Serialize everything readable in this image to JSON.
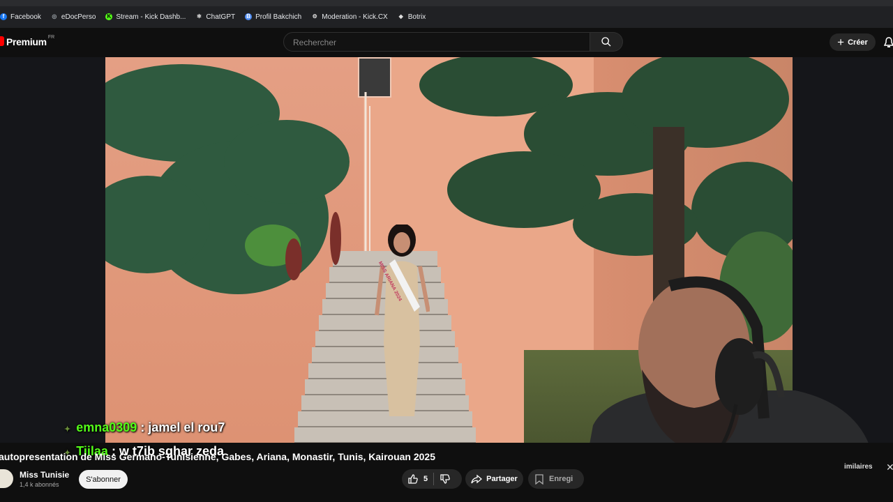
{
  "bookmarks": [
    {
      "label": "Facebook",
      "icon": "facebook-icon",
      "color": "#1877f2",
      "glyph": "f"
    },
    {
      "label": "eDocPerso",
      "icon": "globe-icon",
      "color": "#9aa0a6",
      "glyph": "◎"
    },
    {
      "label": "Stream - Kick Dashb...",
      "icon": "kick-icon",
      "color": "#53fc18",
      "glyph": "K"
    },
    {
      "label": "ChatGPT",
      "icon": "chatgpt-icon",
      "color": "#dddddd",
      "glyph": "✻"
    },
    {
      "label": "Profil Bakchich",
      "icon": "profile-icon",
      "color": "#4f8df5",
      "glyph": "B"
    },
    {
      "label": "Moderation - Kick.CX",
      "icon": "gear-icon",
      "color": "#dddddd",
      "glyph": "⚙"
    },
    {
      "label": "Botrix",
      "icon": "botrix-icon",
      "color": "#dddddd",
      "glyph": "◆"
    }
  ],
  "header": {
    "logo": "Premium",
    "region": "FR",
    "search_placeholder": "Rechercher",
    "create_label": "Créer"
  },
  "chat": [
    {
      "user": "emna0309",
      "message": ": jamel el rou7"
    },
    {
      "user": "Tiilaa",
      "message": ": w t7ib sghar zeda"
    }
  ],
  "video": {
    "sash_text": "MISS ARIANA 2024",
    "title": "autopresentation de Miss Germano-Tunisienne, Gabes, Ariana, Monastir, Tunis, Kairouan 2025"
  },
  "channel": {
    "name": "Miss Tunisie",
    "subscribers": "1,4 k abonnés",
    "subscribe_label": "S'abonner"
  },
  "actions": {
    "likes": "5",
    "share_label": "Partager",
    "save_label": "Enregi",
    "similar_label": "imilaires"
  },
  "colors": {
    "accent": "#ff0000",
    "chat_user": "#53fc18"
  }
}
